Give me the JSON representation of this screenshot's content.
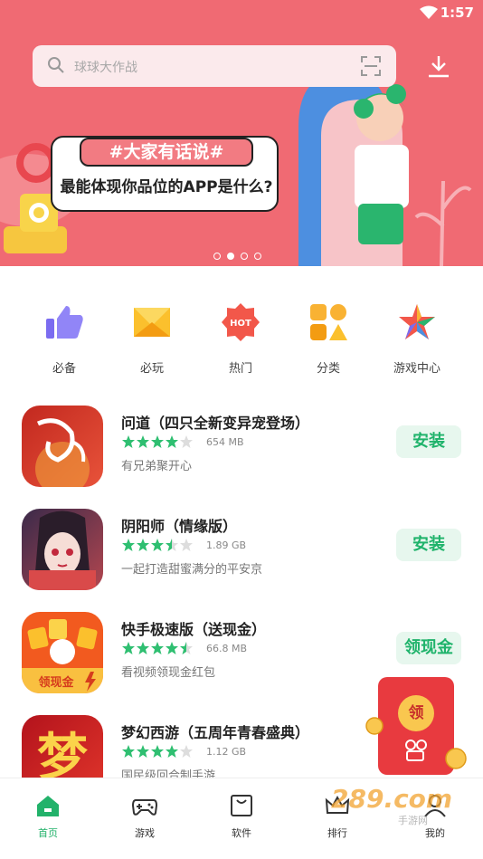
{
  "status_bar": {
    "time": "1:57"
  },
  "search": {
    "placeholder": "球球大作战"
  },
  "banner": {
    "tag": "#大家有话说#",
    "title": "最能体现你品位的APP是什么?",
    "slide_index": 2,
    "slide_count": 4
  },
  "categories": [
    {
      "label": "必备",
      "icon": "thumbs-up-icon"
    },
    {
      "label": "必玩",
      "icon": "ticket-icon"
    },
    {
      "label": "热门",
      "icon": "hot-badge-icon",
      "badge_text": "HOT"
    },
    {
      "label": "分类",
      "icon": "category-grid-icon"
    },
    {
      "label": "游戏中心",
      "icon": "star-icon"
    }
  ],
  "apps": [
    {
      "name": "问道（四只全新变异宠登场）",
      "rating": 4,
      "size": "654 MB",
      "desc": "有兄弟聚开心",
      "action": "安装"
    },
    {
      "name": "阴阳师（情缘版）",
      "rating": 3.5,
      "size": "1.89 GB",
      "desc": "一起打造甜蜜满分的平安京",
      "action": "安装"
    },
    {
      "name": "快手极速版（送现金）",
      "rating": 4.5,
      "size": "66.8 MB",
      "desc": "看视频领现金红包",
      "action": "领现金"
    },
    {
      "name": "梦幻西游（五周年青春盛典）",
      "rating": 4,
      "size": "1.12 GB",
      "desc": "国民级回合制手游",
      "action": ""
    }
  ],
  "app_icon_text": {
    "app3": "领现金",
    "app4": "梦"
  },
  "red_packet": {
    "coin_text": "领"
  },
  "nav": [
    {
      "label": "首页",
      "active": true
    },
    {
      "label": "游戏"
    },
    {
      "label": "软件"
    },
    {
      "label": "排行"
    },
    {
      "label": "我的"
    }
  ],
  "watermark": {
    "text": "289.com",
    "sub": "手游网"
  },
  "colors": {
    "brand_green": "#22b26a",
    "banner_bg": "#f06a73",
    "star": "#2fbf71"
  }
}
